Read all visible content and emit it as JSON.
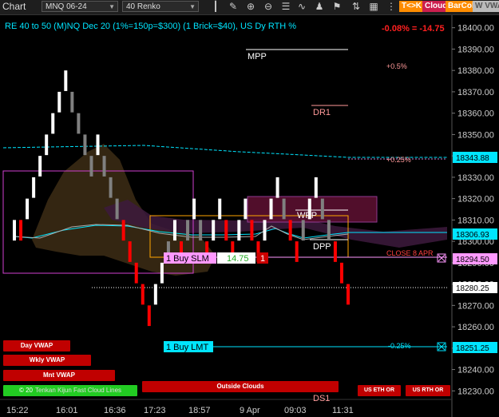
{
  "toolbar": {
    "title": "Chart",
    "instrument": "MNQ 06-24",
    "bar_type": "40 Renko",
    "buttons": [
      {
        "label": "T<>K",
        "color": "#ff8c00",
        "text_color": "#fff"
      },
      {
        "label": "Cloud",
        "color": "#cc1f4f",
        "text_color": "#fff"
      },
      {
        "label": "BarCol",
        "color": "#ff8c00",
        "text_color": "#fff"
      },
      {
        "label": "W VWA",
        "color": "#bbbbbb",
        "text_color": "#555"
      }
    ],
    "icons": [
      "bar-style-icon",
      "drawing-tool-icon",
      "zoom-in-icon",
      "zoom-out-icon",
      "properties-icon",
      "indicators-icon",
      "strategies-icon",
      "templates-icon",
      "chart-trader-icon",
      "data-box-icon"
    ]
  },
  "header": {
    "caption": "RE 40 to 50 (M)NQ Dec 20 (1%=150p=$300) (1 Brick=$40), US Dy RTH %",
    "change": "-0.08% = -14.75"
  },
  "levels": {
    "mpp": "MPP",
    "dr1": "DR1",
    "wpp": "WPP",
    "dpp": "DPP",
    "ds1": "DS1",
    "close": "CLOSE 8 APR",
    "pct_05": "+0.5%",
    "pct_025": "+0.25%",
    "pct_neg025": "-0.25%"
  },
  "orders": {
    "buy_slm_label": "1 Buy SLM",
    "buy_slm_value": "14.75",
    "buy_slm_qty": "1",
    "buy_lmt_label": "1 Buy LMT"
  },
  "indicator_buttons": {
    "day_vwap": "Day VWAP",
    "wkly_vwap": "Wkly VWAP",
    "mnt_vwap": "Mnt VWAP",
    "kijun_cloud": "Tenkan Kijun Fast Cloud Lines",
    "outside_clouds": "Outside Clouds",
    "us_eth_or": "US ETH OR",
    "us_rth_or": "US RTH OR",
    "copyright": "© 20"
  },
  "price_flags": {
    "upper_cyan": "18343.88",
    "mid_cyan": "18306.93",
    "close_pink": "18294.50",
    "last_white": "18280.25",
    "lower_cyan": "18251.25"
  },
  "colors": {
    "up_brick": "#ffffff",
    "down_brick": "#ff0000",
    "neutral_brick": "#808080",
    "cyan": "#00e5ff",
    "magenta": "#d040d0",
    "orange": "#ffa500",
    "flag_cyan": "#00e5ff",
    "flag_pink": "#ff99ff",
    "order_green": "#22cc22"
  },
  "chart_data": {
    "type": "line",
    "title": "RE 40 to 50 (M)NQ Dec 20 (1%=150p=$300) (1 Brick=$40), US Dy RTH %",
    "y_ticks": [
      18400,
      18390,
      18380,
      18370,
      18360,
      18350,
      18340,
      18330,
      18320,
      18310,
      18300,
      18290,
      18280,
      18270,
      18260,
      18250,
      18240,
      18230
    ],
    "y_tick_labels": [
      "18400.00",
      "18390.00",
      "18380.00",
      "18370.00",
      "18360.00",
      "18350.00",
      "18340.00",
      "18330.00",
      "18320.00",
      "18310.00",
      "18300.00",
      "18290.00",
      "18280.00",
      "18270.00",
      "18260.00",
      "18250.00",
      "18240.00",
      "18230.00"
    ],
    "ylim": [
      18226,
      18404
    ],
    "x_tick_labels": [
      "15:22",
      "16:01",
      "16:36",
      "17:23",
      "18:57",
      "9 Apr",
      "09:03",
      "11:31"
    ],
    "bricks": [
      {
        "low": 18300,
        "high": 18310,
        "dir": "up"
      },
      {
        "low": 18300,
        "high": 18310,
        "dir": "down"
      },
      {
        "low": 18310,
        "high": 18320,
        "dir": "up"
      },
      {
        "low": 18320,
        "high": 18330,
        "dir": "up"
      },
      {
        "low": 18330,
        "high": 18340,
        "dir": "up"
      },
      {
        "low": 18340,
        "high": 18350,
        "dir": "up"
      },
      {
        "low": 18350,
        "high": 18360,
        "dir": "up"
      },
      {
        "low": 18360,
        "high": 18370,
        "dir": "up"
      },
      {
        "low": 18370,
        "high": 18380,
        "dir": "up"
      },
      {
        "low": 18360,
        "high": 18370,
        "dir": "neutral"
      },
      {
        "low": 18350,
        "high": 18360,
        "dir": "neutral"
      },
      {
        "low": 18340,
        "high": 18350,
        "dir": "neutral"
      },
      {
        "low": 18330,
        "high": 18340,
        "dir": "neutral"
      },
      {
        "low": 18340,
        "high": 18350,
        "dir": "up"
      },
      {
        "low": 18330,
        "high": 18340,
        "dir": "neutral"
      },
      {
        "low": 18320,
        "high": 18330,
        "dir": "neutral"
      },
      {
        "low": 18310,
        "high": 18320,
        "dir": "neutral"
      },
      {
        "low": 18300,
        "high": 18310,
        "dir": "down"
      },
      {
        "low": 18290,
        "high": 18300,
        "dir": "down"
      },
      {
        "low": 18280,
        "high": 18290,
        "dir": "down"
      },
      {
        "low": 18270,
        "high": 18280,
        "dir": "down"
      },
      {
        "low": 18260,
        "high": 18270,
        "dir": "down"
      },
      {
        "low": 18270,
        "high": 18280,
        "dir": "up"
      },
      {
        "low": 18280,
        "high": 18290,
        "dir": "up"
      },
      {
        "low": 18290,
        "high": 18300,
        "dir": "neutral"
      },
      {
        "low": 18300,
        "high": 18310,
        "dir": "up"
      },
      {
        "low": 18290,
        "high": 18300,
        "dir": "down"
      },
      {
        "low": 18300,
        "high": 18310,
        "dir": "neutral"
      },
      {
        "low": 18310,
        "high": 18320,
        "dir": "up"
      },
      {
        "low": 18300,
        "high": 18310,
        "dir": "neutral"
      },
      {
        "low": 18290,
        "high": 18300,
        "dir": "down"
      },
      {
        "low": 18300,
        "high": 18310,
        "dir": "up"
      },
      {
        "low": 18310,
        "high": 18320,
        "dir": "up"
      },
      {
        "low": 18300,
        "high": 18310,
        "dir": "down"
      },
      {
        "low": 18290,
        "high": 18300,
        "dir": "down"
      },
      {
        "low": 18300,
        "high": 18310,
        "dir": "up"
      },
      {
        "low": 18310,
        "high": 18320,
        "dir": "up"
      },
      {
        "low": 18300,
        "high": 18310,
        "dir": "down"
      },
      {
        "low": 18290,
        "high": 18300,
        "dir": "down"
      },
      {
        "low": 18300,
        "high": 18310,
        "dir": "up"
      },
      {
        "low": 18310,
        "high": 18320,
        "dir": "up"
      },
      {
        "low": 18320,
        "high": 18330,
        "dir": "up"
      },
      {
        "low": 18310,
        "high": 18320,
        "dir": "neutral"
      },
      {
        "low": 18300,
        "high": 18310,
        "dir": "down"
      },
      {
        "low": 18290,
        "high": 18300,
        "dir": "down"
      },
      {
        "low": 18300,
        "high": 18310,
        "dir": "neutral"
      },
      {
        "low": 18310,
        "high": 18320,
        "dir": "up"
      },
      {
        "low": 18320,
        "high": 18330,
        "dir": "up"
      },
      {
        "low": 18310,
        "high": 18320,
        "dir": "neutral"
      },
      {
        "low": 18300,
        "high": 18310,
        "dir": "neutral"
      },
      {
        "low": 18290,
        "high": 18300,
        "dir": "down"
      },
      {
        "low": 18280,
        "high": 18290,
        "dir": "down"
      },
      {
        "low": 18270,
        "high": 18280,
        "dir": "down"
      }
    ]
  }
}
